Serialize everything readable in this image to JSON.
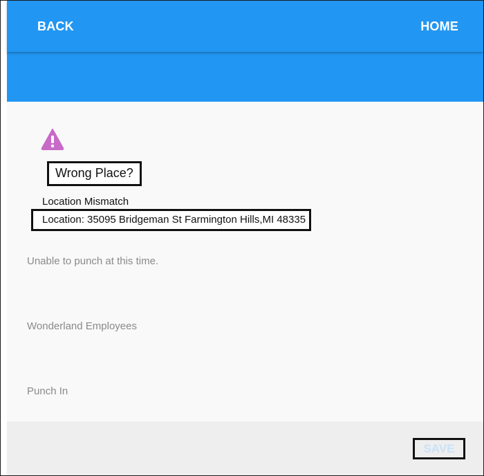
{
  "nav": {
    "back_label": "BACK",
    "home_label": "HOME"
  },
  "alert": {
    "icon": "warning-triangle-icon",
    "icon_color": "#c86ac7",
    "title": "Wrong Place?",
    "mismatch_label": "Location Mismatch",
    "location_text": "Location: 35095 Bridgeman St Farmington Hills,MI 48335"
  },
  "details": {
    "message": "Unable to punch at this time.",
    "group": "Wonderland Employees",
    "action": "Punch In"
  },
  "footer": {
    "save_label": "SAVE"
  },
  "colors": {
    "header_blue": "#2196f3",
    "save_disabled": "#c9e2f8",
    "muted_text": "#8a8a8a"
  }
}
